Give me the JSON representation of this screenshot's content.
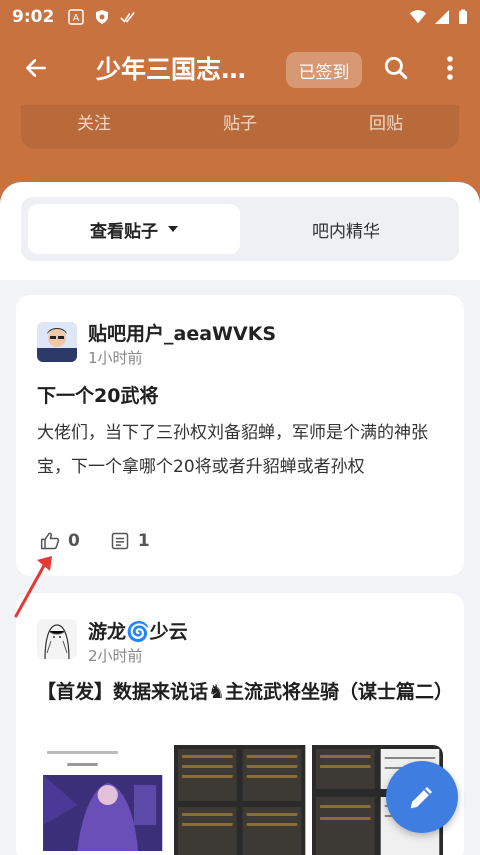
{
  "status_bar": {
    "time": "9:02",
    "icons": [
      "a-letter-icon",
      "shield-icon",
      "double-check-icon",
      "wifi-icon",
      "signal-icon",
      "battery-icon"
    ]
  },
  "toolbar": {
    "title": "少年三国志…",
    "signed_label": "已签到"
  },
  "stats": {
    "follow": "关注",
    "posts": "贴子",
    "replies": "回贴"
  },
  "tabs": {
    "view_posts": "查看贴子",
    "featured": "吧内精华"
  },
  "posts": [
    {
      "user": "贴吧用户_aeaWVKS",
      "time": "1小时前",
      "title": "下一个20武将",
      "body": "大佬们，当下了三孙权刘备貂蝉，军师是个满的神张宝，下一个拿哪个20将或者升貂蝉或者孙权",
      "likes": "0",
      "comments": "1"
    },
    {
      "user": "游龙🌀少云",
      "time": "2小时前",
      "title": "【首发】数据来说话♞主流武将坐骑（谋士篇二）"
    }
  ],
  "colors": {
    "header": "#c8723f",
    "accent": "#3f7ee0",
    "annotation": "#e53935"
  }
}
